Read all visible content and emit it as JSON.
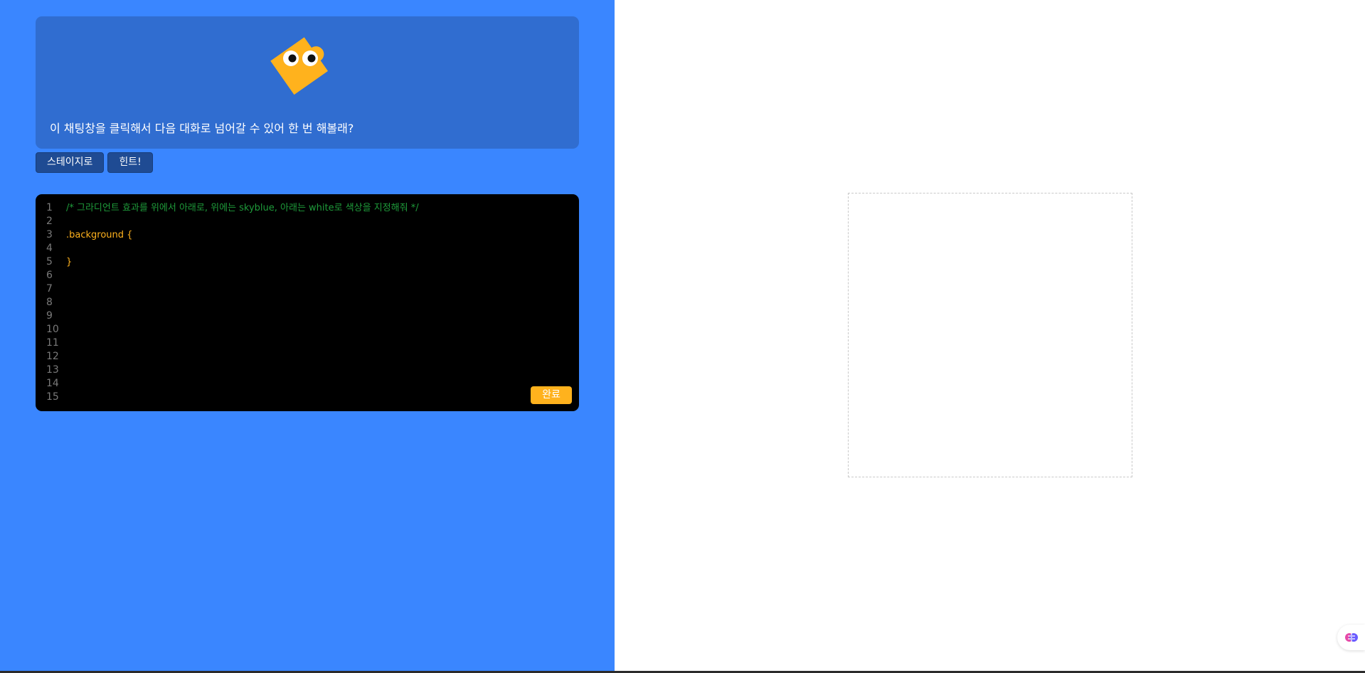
{
  "chat": {
    "message": "이 채팅창을 클릭해서 다음 대화로 넘어갈 수 있어 한 번 해볼래?"
  },
  "buttons": {
    "stage_label": "스테이지로",
    "hint_label": "힌트!"
  },
  "editor": {
    "line_numbers": [
      "1",
      "2",
      "3",
      "4",
      "5",
      "6",
      "7",
      "8",
      "9",
      "10",
      "11",
      "12",
      "13",
      "14",
      "15"
    ],
    "lines": [
      "/* 그라디언트 효과를 위에서 아래로, 위에는 skyblue, 아래는 white로 색상을 지정해줘 */",
      "",
      ".background {",
      "",
      "}",
      "",
      "",
      "",
      "",
      "",
      "",
      "",
      "",
      "",
      ""
    ],
    "done_label": "완료"
  },
  "colors": {
    "left_bg": "#3a86ff",
    "chat_bg": "#306dd0",
    "button_bg": "#1f4b93",
    "accent": "#ffb21d",
    "comment": "#1e9b3a",
    "mascot": "#ffb21d"
  },
  "icons": {
    "mascot": "puzzle-piece-mascot",
    "widget": "brain-icon"
  }
}
